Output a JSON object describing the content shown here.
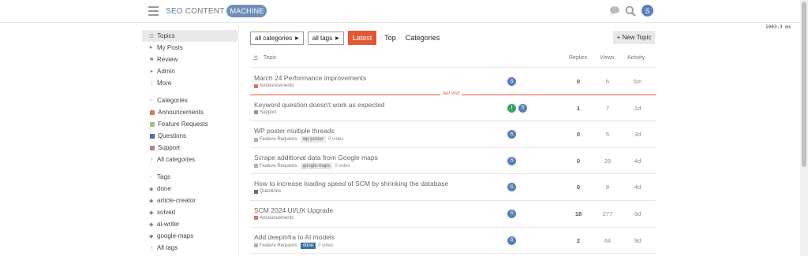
{
  "header": {
    "logo_part1": "SEO",
    "logo_part2": "CONTENT",
    "logo_part3": "MACHINE",
    "avatar_letter": "S",
    "timing": "1003.3 ms"
  },
  "sidebar": {
    "items": [
      {
        "label": "Topics",
        "icon": "topics-icon"
      },
      {
        "label": "My Posts",
        "icon": "user-icon"
      },
      {
        "label": "Review",
        "icon": "flag-icon"
      },
      {
        "label": "Admin",
        "icon": "wrench-icon"
      },
      {
        "label": "More",
        "icon": "more-icon"
      }
    ],
    "categories_heading": "Categories",
    "categories": [
      {
        "label": "Announcements",
        "color": "#d57a5f"
      },
      {
        "label": "Feature Requests",
        "color": "#9cc48a"
      },
      {
        "label": "Questions",
        "color": "#4d6fa3"
      },
      {
        "label": "Support",
        "color": "#b7839b"
      },
      {
        "label": "All categories",
        "color": ""
      }
    ],
    "tags_heading": "Tags",
    "tags": [
      "done",
      "article-creator",
      "solved",
      "ai-writer",
      "google-maps",
      "All tags"
    ]
  },
  "toolbar": {
    "all_categories": "all categories",
    "all_tags": "all tags",
    "latest": "Latest",
    "top": "Top",
    "categories": "Categories",
    "new_topic": "+ New Topic"
  },
  "table": {
    "col_topic": "Topic",
    "col_replies": "Replies",
    "col_views": "Views",
    "col_activity": "Activity",
    "last_visit": "last visit",
    "rows": [
      {
        "title": "March 24 Performance improvements",
        "category": "Announcements",
        "cat_color": "#d57a5f",
        "tag": "",
        "votes": "",
        "posters": [
          "S"
        ],
        "replies": "0",
        "views": "6",
        "activity": "5m"
      },
      {
        "title": "Keyword question doesn't work as expected",
        "category": "Support",
        "cat_color": "#b7839b",
        "tag": "",
        "votes": "",
        "posters": [
          "I",
          "S"
        ],
        "replies": "1",
        "views": "7",
        "activity": "1d"
      },
      {
        "title": "WP poster multiple threads",
        "category": "Feature Requests",
        "cat_color": "#9cc48a",
        "tag": "wp-poster",
        "votes": "0 votes",
        "posters": [
          "S"
        ],
        "replies": "0",
        "views": "5",
        "activity": "3d"
      },
      {
        "title": "Scrape additional data from Google maps",
        "category": "Feature Requests",
        "cat_color": "#9cc48a",
        "tag": "google-maps",
        "votes": "0 votes",
        "posters": [
          "S"
        ],
        "replies": "0",
        "views": "29",
        "activity": "4d"
      },
      {
        "title": "How to increase loading speed of SCM by shrinking the database",
        "category": "Questions",
        "cat_color": "#4d6fa3",
        "tag": "",
        "votes": "",
        "posters": [
          "S"
        ],
        "replies": "0",
        "views": "8",
        "activity": "4d"
      },
      {
        "title": "SCM 2024 UI/UX Upgrade",
        "category": "Announcements",
        "cat_color": "#d57a5f",
        "tag": "",
        "votes": "",
        "posters": [
          "S"
        ],
        "replies": "18",
        "views": "277",
        "activity": "6d"
      },
      {
        "title": "Add deepinfra to AI models",
        "category": "Feature Requests",
        "cat_color": "#9cc48a",
        "tag": "done",
        "votes": "0 votes",
        "posters": [
          "S"
        ],
        "replies": "2",
        "views": "64",
        "activity": "9d"
      }
    ]
  }
}
